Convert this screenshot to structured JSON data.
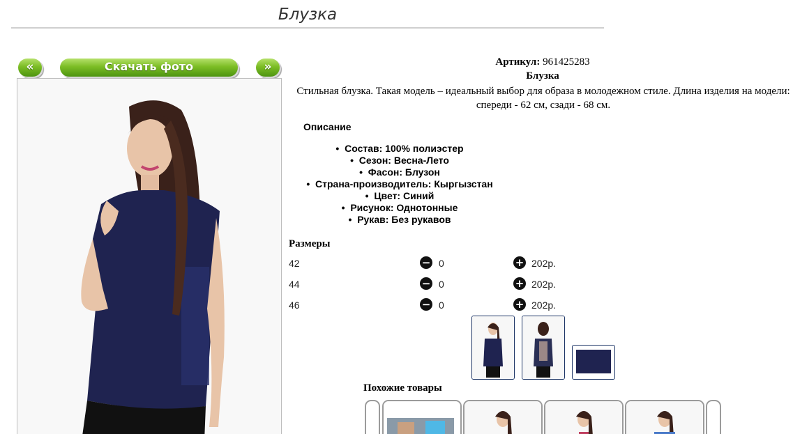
{
  "page": {
    "title": "Блузка"
  },
  "gallery": {
    "prev_label": "«",
    "download_label": "Скачать фото",
    "next_label": "»"
  },
  "product": {
    "article_label": "Артикул:",
    "article_value": "961425283",
    "name": "Блузка",
    "description": "Стильная блузка. Такая модель – идеальный выбор для образа в молодежном стиле. Длина изделия на модели: спереди - 62 см, сзади - 68 см.",
    "desc_heading": "Описание",
    "properties": [
      "Состав: 100% полиэстер",
      "Сезон: Весна-Лето",
      "Фасон: Блузон",
      "Страна-производитель: Кыргызстан",
      "Цвет: Синий",
      "Рисунок: Однотонные",
      "Рукав: Без рукавов"
    ],
    "color": "#1f2350"
  },
  "sizes": {
    "heading": "Размеры",
    "rows": [
      {
        "size": "42",
        "qty": "0",
        "price": "202р."
      },
      {
        "size": "44",
        "qty": "0",
        "price": "202р."
      },
      {
        "size": "46",
        "qty": "0",
        "price": "202р."
      }
    ],
    "minus_icon": "minus-circle-icon",
    "plus_icon": "plus-circle-icon"
  },
  "similar": {
    "heading": "Похожие товары"
  },
  "colors": {
    "button_green": "#7cbd25",
    "thumb_border": "#1d3566"
  }
}
